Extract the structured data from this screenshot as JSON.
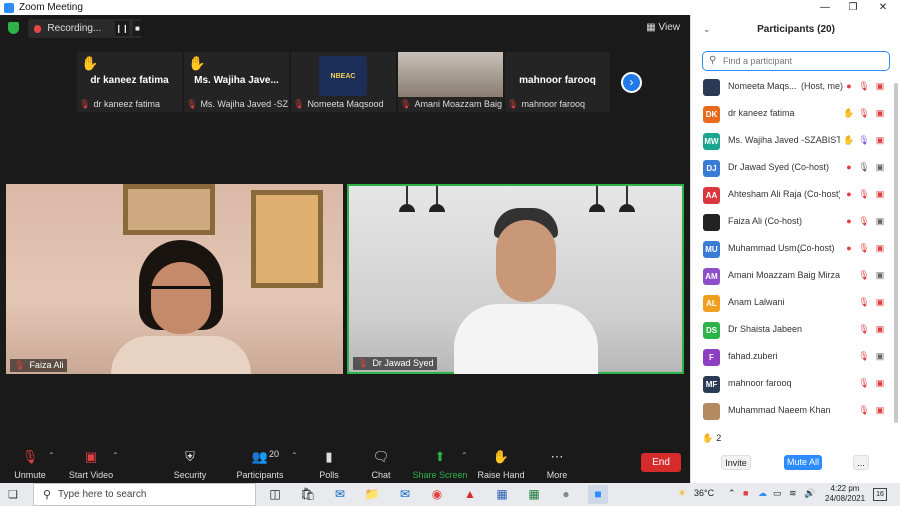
{
  "window": {
    "title": "Zoom Meeting"
  },
  "recording": {
    "label": "Recording..."
  },
  "view_label": "View",
  "strip": [
    {
      "big": "dr kaneez fatima",
      "name": "dr kaneez fatima",
      "hand": true
    },
    {
      "big": "Ms. Wajiha Jave...",
      "name": "Ms. Wajiha Javed -SZABI...",
      "hand": true
    },
    {
      "name": "Nomeeta Maqsood",
      "logo": "NBEAC"
    },
    {
      "name": "Amani Moazzam Baig..."
    },
    {
      "big": "mahnoor farooq",
      "name": "mahnoor farooq"
    }
  ],
  "videos": {
    "left_name": "Faiza Ali",
    "right_name": "Dr Jawad Syed"
  },
  "toolbar": {
    "unmute": "Unmute",
    "start_video": "Start Video",
    "security": "Security",
    "participants": "Participants",
    "participants_count": "20",
    "polls": "Polls",
    "chat": "Chat",
    "share_screen": "Share Screen",
    "raise_hand": "Raise Hand",
    "more": "More",
    "end": "End"
  },
  "panel": {
    "title": "Participants (20)",
    "search_placeholder": "Find a participant",
    "participants": [
      {
        "initials": "",
        "color": "#2b3a55",
        "name": "Nomeeta Maqs...",
        "role": "(Host, me)"
      },
      {
        "initials": "DK",
        "color": "#e86a1f",
        "name": "dr kaneez fatima",
        "role": ""
      },
      {
        "initials": "MW",
        "color": "#1aa58f",
        "name": "Ms. Wajiha Javed -SZABIST",
        "role": ""
      },
      {
        "initials": "DJ",
        "color": "#3a7bd5",
        "name": "Dr Jawad Syed (Co-host)",
        "role": ""
      },
      {
        "initials": "AA",
        "color": "#d9363e",
        "name": "Ahtesham Ali Raja (Co-host)",
        "role": ""
      },
      {
        "initials": "",
        "color": "#222222",
        "name": "Faiza Ali (Co-host)",
        "role": ""
      },
      {
        "initials": "MU",
        "color": "#3a7bd5",
        "name": "Muhammad Usm...",
        "role": "(Co-host)"
      },
      {
        "initials": "AM",
        "color": "#8e4ec6",
        "name": "Amani Moazzam Baig Mirza",
        "role": ""
      },
      {
        "initials": "AL",
        "color": "#f0a020",
        "name": "Anam Lalwani",
        "role": ""
      },
      {
        "initials": "DS",
        "color": "#2cb34a",
        "name": "Dr Shaista Jabeen",
        "role": ""
      },
      {
        "initials": "F",
        "color": "#8e3ec0",
        "name": "fahad.zuberi",
        "role": ""
      },
      {
        "initials": "MF",
        "color": "#2b3a55",
        "name": "mahnoor farooq",
        "role": ""
      },
      {
        "initials": "",
        "color": "#b48a60",
        "name": "Muhammad Naeem Khan",
        "role": ""
      }
    ],
    "hands_count": "2",
    "invite": "Invite",
    "mute_all": "Mute All",
    "more": "..."
  },
  "taskbar": {
    "search_text": "Type here to search",
    "temperature": "36°C",
    "time": "4:22 pm",
    "date": "24/08/2021",
    "notifications": "16"
  }
}
